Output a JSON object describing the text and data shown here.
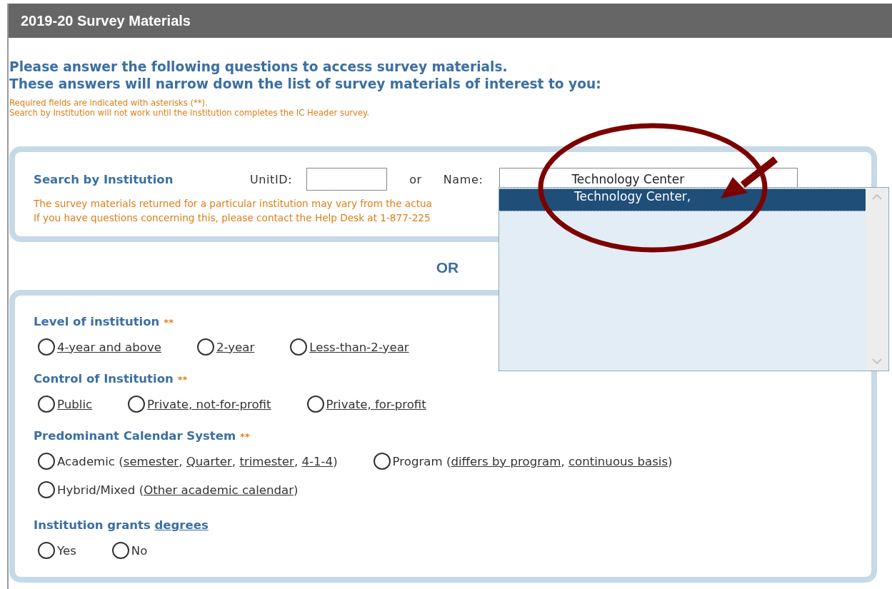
{
  "header": {
    "title": "2019-20 Survey Materials"
  },
  "intro": {
    "lines": [
      "Please answer the following questions to access survey materials.",
      "These answers will narrow down the list of survey materials of interest to you:"
    ],
    "notes": [
      "Required fields are indicated with asterisks (**).",
      "Search by Institution will not work until the institution completes the IC Header survey."
    ]
  },
  "search": {
    "title": "Search by Institution",
    "unitid_label": "UnitID:",
    "or_label": "or",
    "name_label": "Name:",
    "name_value": "Technology Center",
    "notes": [
      "The survey materials returned for a particular institution may vary from the actua",
      "If you have questions concerning this, please contact the Help Desk at 1-877-225"
    ]
  },
  "separator": "OR",
  "sections": [
    {
      "heading": [
        {
          "text": "Level of institution",
          "link": false
        }
      ],
      "marker": "**",
      "rows": [
        [
          {
            "selected": false,
            "parts": [
              {
                "text": "4-year and above",
                "link": true
              }
            ]
          },
          {
            "selected": false,
            "parts": [
              {
                "text": "2-year",
                "link": true
              }
            ]
          },
          {
            "selected": false,
            "parts": [
              {
                "text": "Less-than-2-year",
                "link": true
              }
            ]
          }
        ]
      ]
    },
    {
      "heading": [
        {
          "text": "Control of Institution",
          "link": false
        }
      ],
      "marker": "**",
      "rows": [
        [
          {
            "selected": false,
            "parts": [
              {
                "text": "Public",
                "link": true
              }
            ]
          },
          {
            "selected": false,
            "parts": [
              {
                "text": "Private, not-for-profit",
                "link": true
              }
            ]
          },
          {
            "selected": false,
            "parts": [
              {
                "text": "Private, for-profit",
                "link": true
              }
            ]
          }
        ]
      ]
    },
    {
      "heading": [
        {
          "text": "Predominant Calendar System",
          "link": false
        }
      ],
      "marker": "**",
      "rows": [
        [
          {
            "selected": false,
            "parts": [
              {
                "text": "Academic (",
                "link": false
              },
              {
                "text": "semester",
                "link": true
              },
              {
                "text": ", ",
                "link": false
              },
              {
                "text": "Quarter",
                "link": true
              },
              {
                "text": ", ",
                "link": false
              },
              {
                "text": "trimester",
                "link": true
              },
              {
                "text": ", ",
                "link": false
              },
              {
                "text": "4-1-4",
                "link": true
              },
              {
                "text": ")",
                "link": false
              }
            ]
          },
          {
            "selected": false,
            "parts": [
              {
                "text": "Program (",
                "link": false
              },
              {
                "text": "differs by program",
                "link": true
              },
              {
                "text": ", ",
                "link": false
              },
              {
                "text": "continuous basis",
                "link": true
              },
              {
                "text": ")",
                "link": false
              }
            ]
          }
        ],
        [
          {
            "selected": false,
            "parts": [
              {
                "text": "Hybrid/Mixed (",
                "link": false
              },
              {
                "text": "Other academic calendar",
                "link": true
              },
              {
                "text": ")",
                "link": false
              }
            ]
          }
        ]
      ]
    },
    {
      "heading": [
        {
          "text": "Institution grants ",
          "link": false
        },
        {
          "text": "degrees",
          "link": true
        }
      ],
      "rows": [
        [
          {
            "selected": false,
            "parts": [
              {
                "text": "Yes",
                "link": false
              }
            ]
          },
          {
            "selected": false,
            "parts": [
              {
                "text": "No",
                "link": false
              }
            ]
          }
        ]
      ]
    }
  ],
  "dropdown": {
    "items": [
      {
        "text": "Technology Center,",
        "selected": true
      }
    ]
  }
}
